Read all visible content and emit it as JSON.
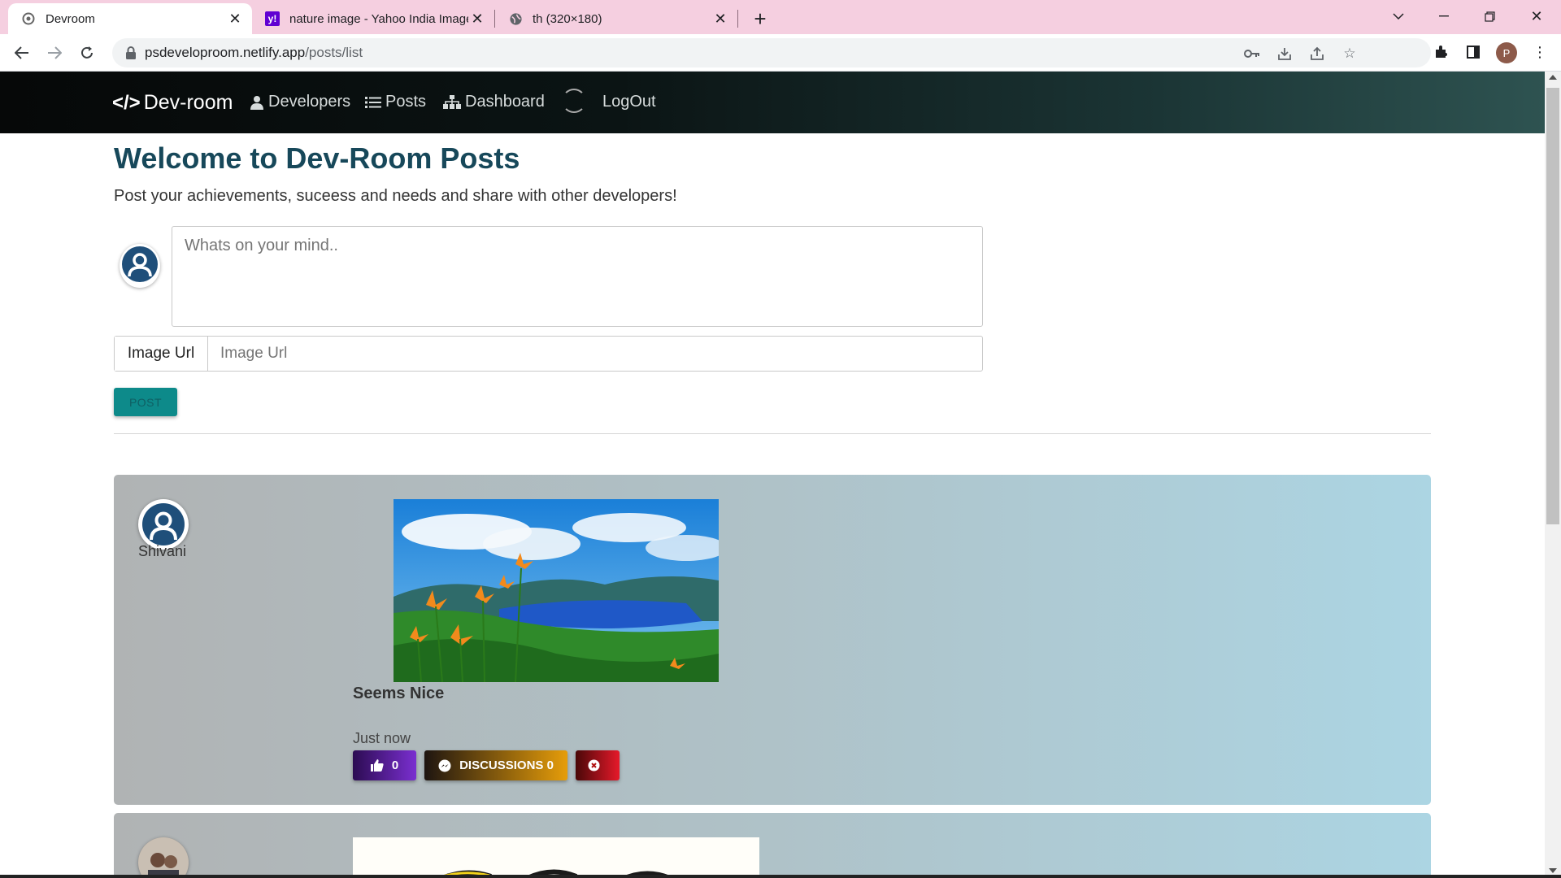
{
  "browser": {
    "tabs": [
      {
        "title": "Devroom",
        "active": true
      },
      {
        "title": "nature image - Yahoo India Image",
        "active": false
      },
      {
        "title": "th (320×180)",
        "active": false
      }
    ],
    "url_host": "psdeveloproom.netlify.app",
    "url_path": "/posts/list",
    "profile_initial": "P"
  },
  "nav": {
    "brand": "Dev-room",
    "brand_code": "</>",
    "links": [
      "Developers",
      "Posts",
      "Dashboard",
      "LogOut"
    ]
  },
  "page": {
    "title": "Welcome to Dev-Room Posts",
    "lead": "Post your achievements, suceess and needs and share with other developers!",
    "textarea_placeholder": "Whats on your mind..",
    "image_url_label": "Image Url",
    "image_url_placeholder": "Image Url",
    "post_button": "POST"
  },
  "posts": [
    {
      "user": "Shivani",
      "text": "Seems Nice",
      "time": "Just now",
      "likes": "0",
      "discussions_label": "DISCUSSIONS 0"
    }
  ],
  "colors": {
    "title": "#17485a",
    "post_button": "#0d8a8a",
    "like_button": "#7a2fd0",
    "discussion_button": "#e69d0a",
    "delete_button": "#e6192a"
  }
}
